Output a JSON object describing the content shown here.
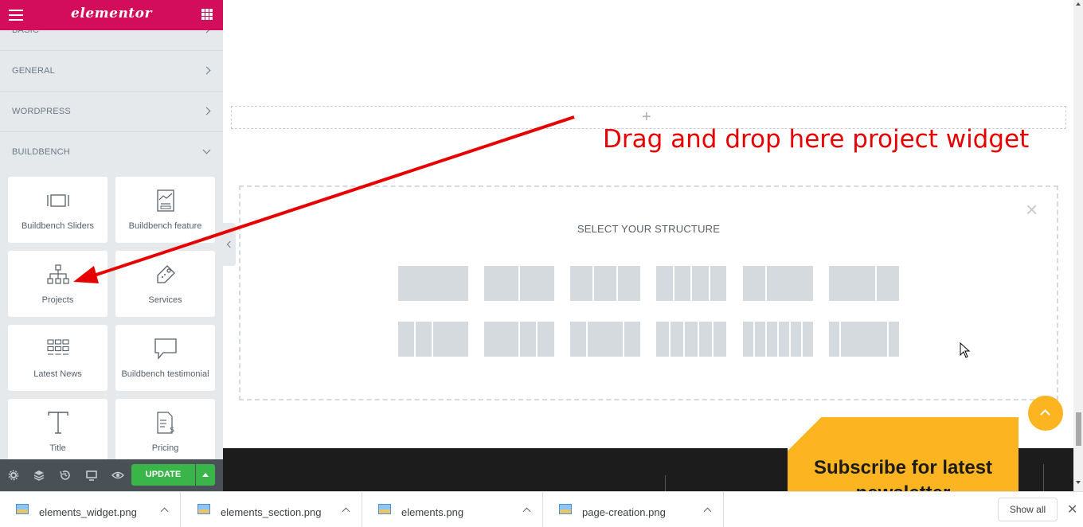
{
  "app": {
    "logo": "elementor"
  },
  "sidebar": {
    "categories": [
      {
        "label": "BASIC",
        "state": "collapsed"
      },
      {
        "label": "GENERAL",
        "state": "collapsed"
      },
      {
        "label": "WORDPRESS",
        "state": "collapsed"
      },
      {
        "label": "BUILDBENCH",
        "state": "expanded"
      }
    ],
    "widgets": [
      {
        "label": "Buildbench Sliders",
        "icon": "slider-icon"
      },
      {
        "label": "Buildbench feature",
        "icon": "feature-icon"
      },
      {
        "label": "Projects",
        "icon": "sitemap-icon"
      },
      {
        "label": "Services",
        "icon": "tag-icon"
      },
      {
        "label": "Latest News",
        "icon": "grid-posts-icon"
      },
      {
        "label": "Buildbench testimonial",
        "icon": "speech-bubble-icon"
      },
      {
        "label": "Title",
        "icon": "text-t-icon"
      },
      {
        "label": "Pricing",
        "icon": "price-list-icon"
      }
    ],
    "footer": {
      "update_label": "UPDATE",
      "icons": [
        "settings-icon",
        "layers-icon",
        "history-icon",
        "responsive-icon",
        "preview-icon"
      ]
    }
  },
  "canvas": {
    "add_section_symbol": "+",
    "annotation": "Drag and drop here project widget",
    "structure_title": "SELECT YOUR STRUCTURE",
    "structure_close": "×",
    "subscribe_text": "Subscribe for latest newsletter"
  },
  "downloads": {
    "items": [
      {
        "name": "elements_widget.png"
      },
      {
        "name": "elements_section.png"
      },
      {
        "name": "elements.png"
      },
      {
        "name": "page-creation.png"
      }
    ],
    "show_all": "Show all",
    "close": "✕"
  },
  "colors": {
    "brand": "#d30c5c",
    "update": "#39b54a",
    "accent": "#fcb521",
    "annotation": "#e60000"
  }
}
